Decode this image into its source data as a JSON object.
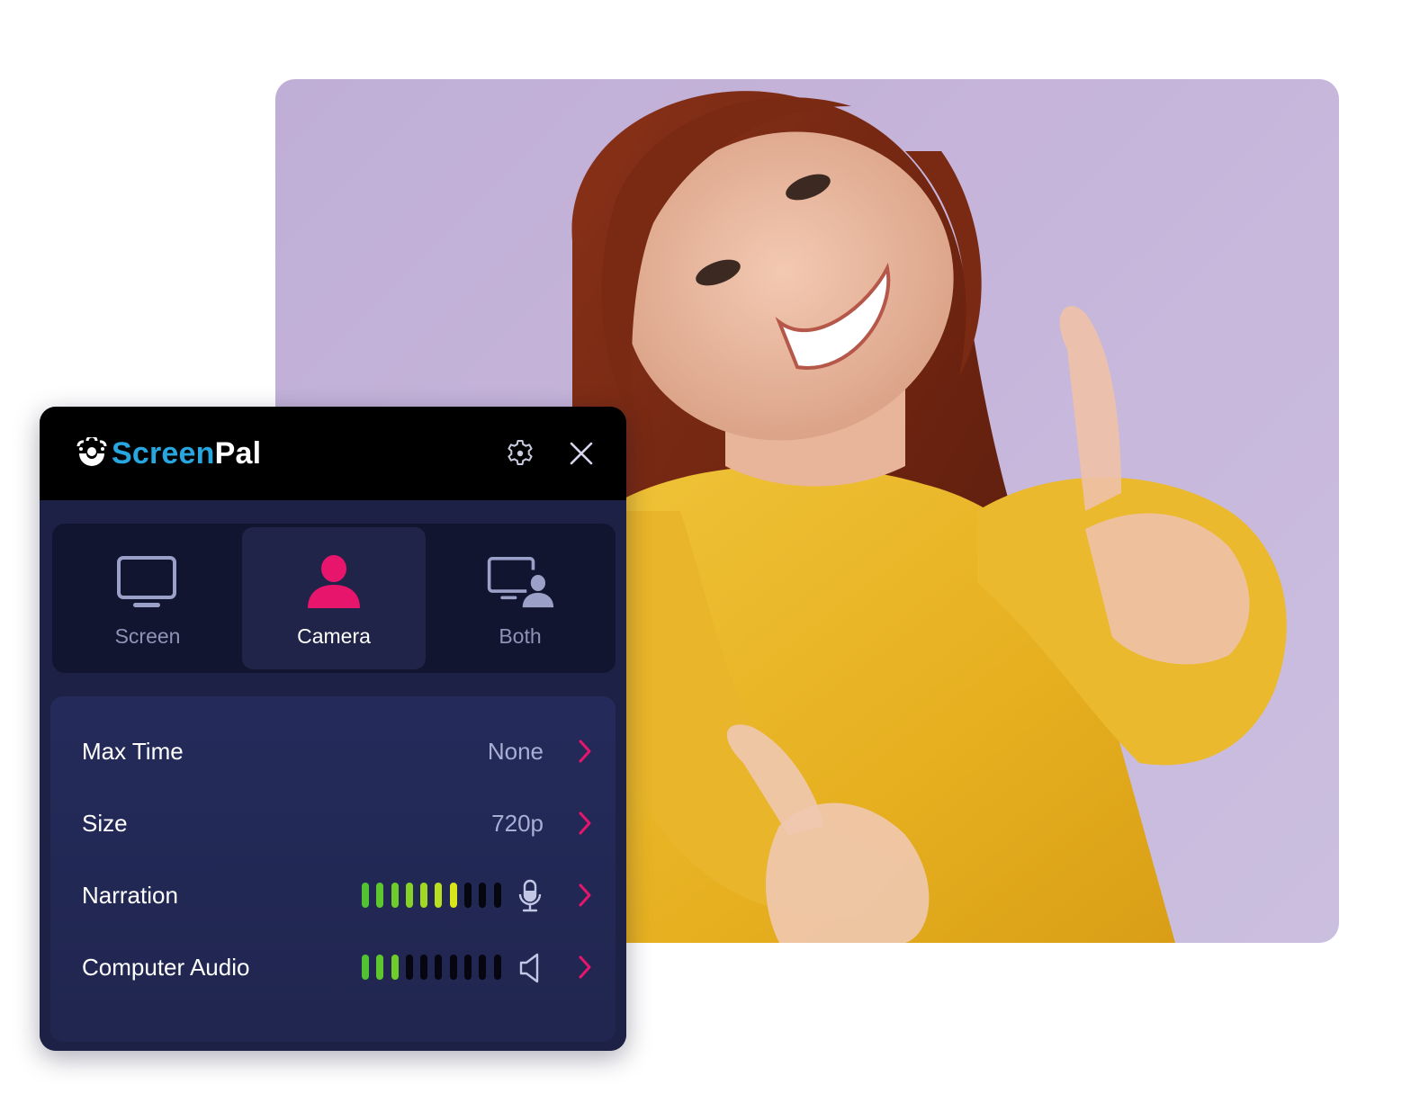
{
  "photo": {
    "description": "smiling woman with red hair in yellow sweater giving thumbs up on lavender background"
  },
  "app": {
    "brand_part1": "Screen",
    "brand_part2": "Pal",
    "icons": {
      "settings": "gear-icon",
      "close": "close-icon"
    }
  },
  "modes": {
    "selected": "Camera",
    "items": [
      {
        "label": "Screen",
        "icon": "monitor-icon",
        "active": false
      },
      {
        "label": "Camera",
        "icon": "person-icon",
        "active": true
      },
      {
        "label": "Both",
        "icon": "monitor-person-icon",
        "active": false
      }
    ]
  },
  "settings": {
    "max_time": {
      "label": "Max Time",
      "value": "None"
    },
    "size": {
      "label": "Size",
      "value": "720p"
    },
    "narration": {
      "label": "Narration",
      "icon": "microphone-icon",
      "level_segments_lit": 7,
      "level_segments_total": 10
    },
    "computer_audio": {
      "label": "Computer Audio",
      "icon": "speaker-icon",
      "level_segments_lit": 3,
      "level_segments_total": 10
    }
  },
  "colors": {
    "accent": "#e8156d",
    "brand_blue": "#27a6e0",
    "panel_bg": "#1c2145",
    "meter_off": "#05060f",
    "meter_gradient": [
      "#52c234",
      "#5ec72e",
      "#6fcd2a",
      "#86d227",
      "#a0d823",
      "#bade20",
      "#d8e41c",
      "#e8e61a",
      "#eee518",
      "#f0e216"
    ],
    "icon_muted": "#9aa0c8"
  }
}
